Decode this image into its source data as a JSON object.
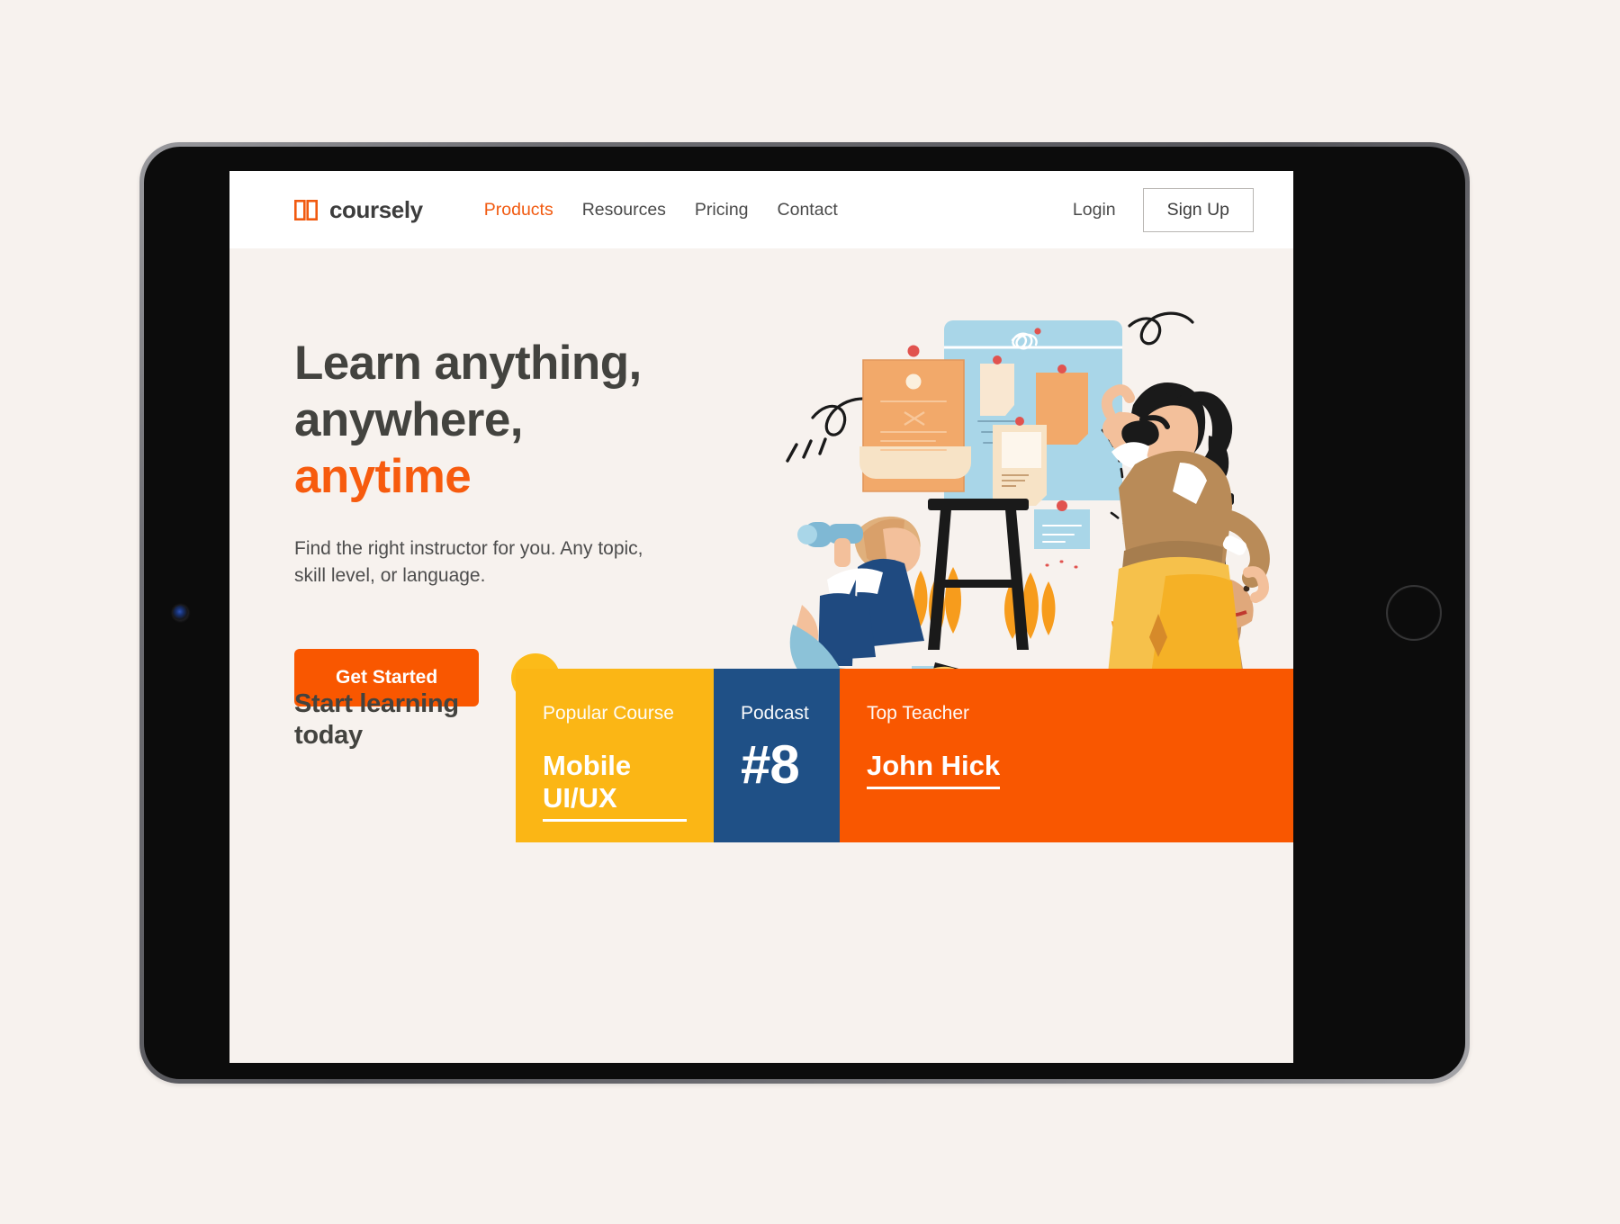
{
  "brand": {
    "name": "coursely",
    "icon": "open-book-icon",
    "color": "#f15a10"
  },
  "nav": {
    "links": [
      {
        "label": "Products",
        "active": true
      },
      {
        "label": "Resources",
        "active": false
      },
      {
        "label": "Pricing",
        "active": false
      },
      {
        "label": "Contact",
        "active": false
      }
    ],
    "login_label": "Login",
    "signup_label": "Sign Up"
  },
  "hero": {
    "title_line1": "Learn anything,",
    "title_line2": "anywhere,",
    "title_accent": "anytime",
    "subtitle_line1": "Find the right instructor for you. Any topic,",
    "subtitle_line2": "skill level, or language.",
    "cta_label": "Get Started",
    "play_icon": "play-icon"
  },
  "bottom": {
    "heading_line1": "Start learning",
    "heading_line2": "today",
    "cards": [
      {
        "kicker": "Popular Course",
        "value": "Mobile UI/UX",
        "color": "#fbb615"
      },
      {
        "kicker": "Podcast",
        "value": "#8",
        "color": "#1f5086"
      },
      {
        "kicker": "Top Teacher",
        "value": "John Hick",
        "color": "#f95700"
      }
    ]
  },
  "colors": {
    "page_bg": "#f7f2ee",
    "orange": "#f95700",
    "yellow": "#fbb615",
    "blue": "#1f5086",
    "text_dark": "#43433f"
  }
}
